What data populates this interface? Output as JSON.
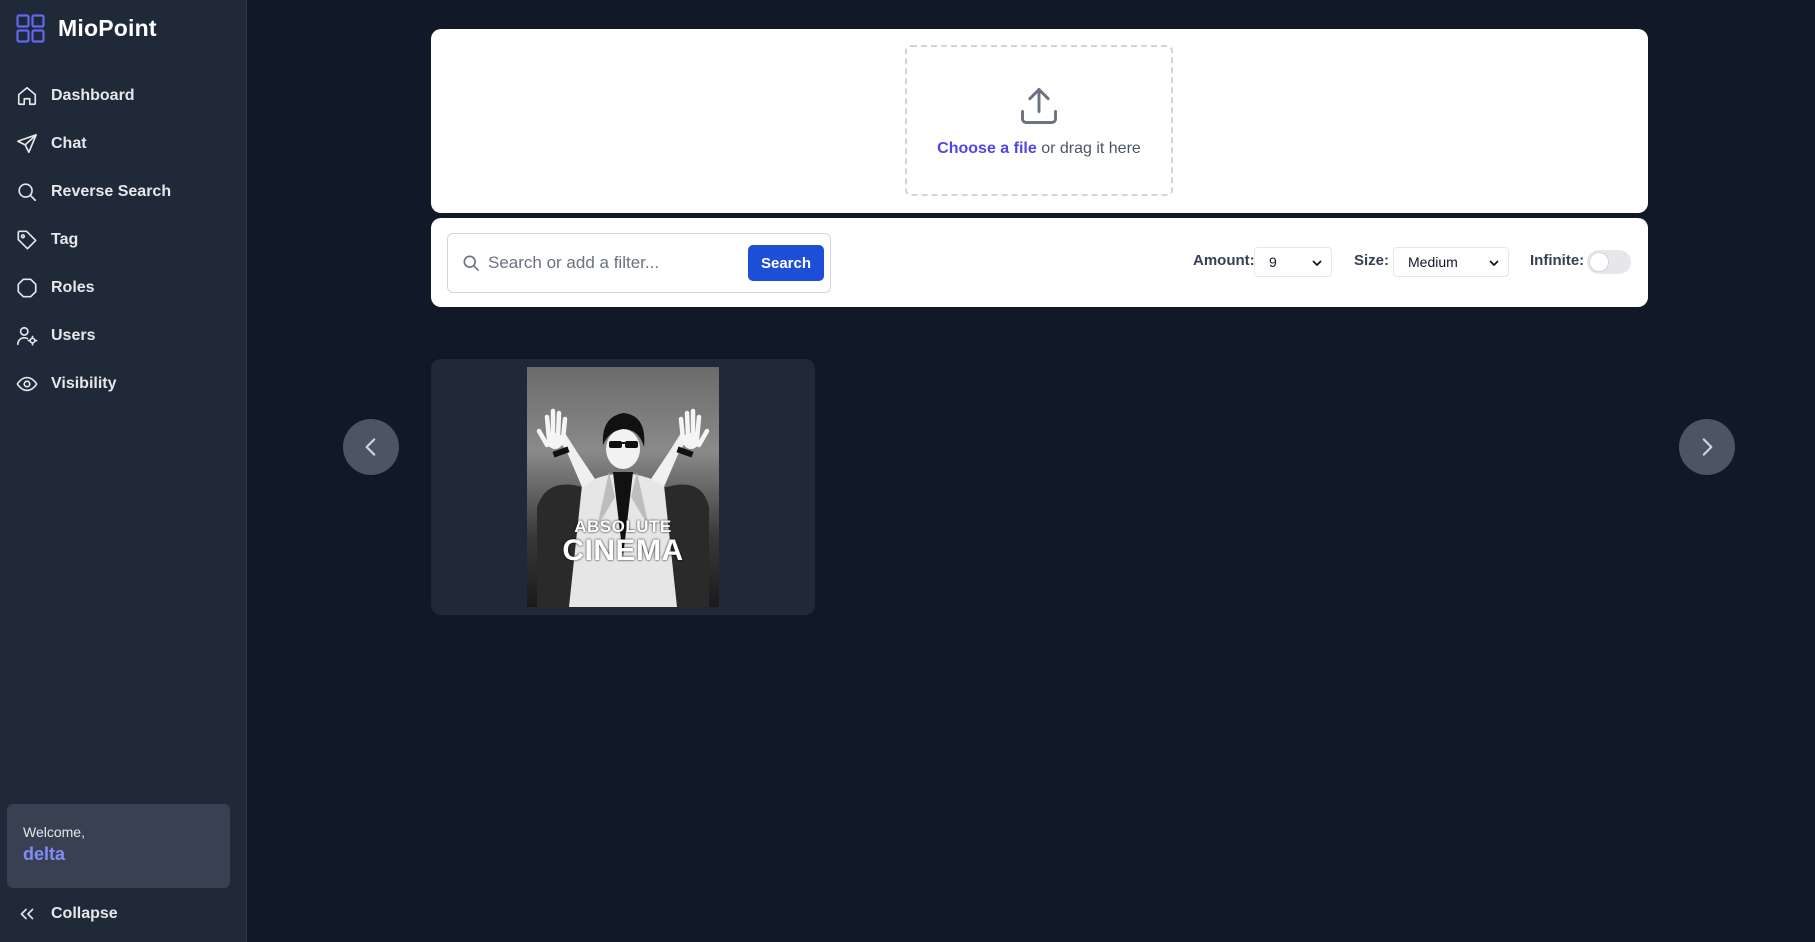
{
  "brand": {
    "name": "MioPoint",
    "icon": "grid-icon",
    "accent": "#6366f1"
  },
  "sidebar": {
    "items": [
      {
        "label": "Dashboard",
        "icon": "home-icon"
      },
      {
        "label": "Chat",
        "icon": "send-icon"
      },
      {
        "label": "Reverse Search",
        "icon": "search-icon"
      },
      {
        "label": "Tag",
        "icon": "tag-icon"
      },
      {
        "label": "Roles",
        "icon": "octagon-icon"
      },
      {
        "label": "Users",
        "icon": "user-cog-icon"
      },
      {
        "label": "Visibility",
        "icon": "eye-icon"
      }
    ],
    "welcome_label": "Welcome,",
    "username": "delta",
    "collapse_label": "Collapse"
  },
  "upload": {
    "choose_label": "Choose a file",
    "drag_text": " or drag it here",
    "icon": "upload-icon"
  },
  "search": {
    "placeholder": "Search or add a filter...",
    "value": "",
    "button_label": "Search"
  },
  "controls": {
    "amount_label": "Amount:",
    "amount_value": "9",
    "size_label": "Size:",
    "size_value": "Medium",
    "infinite_label": "Infinite:",
    "infinite_on": false
  },
  "gallery": {
    "items": [
      {
        "line1": "ABSOLUTE",
        "line2": "CINEMA"
      }
    ]
  },
  "colors": {
    "background": "#111827",
    "sidebar": "#1f2937",
    "primary_button": "#1d4ed8",
    "link": "#4f46e5"
  }
}
